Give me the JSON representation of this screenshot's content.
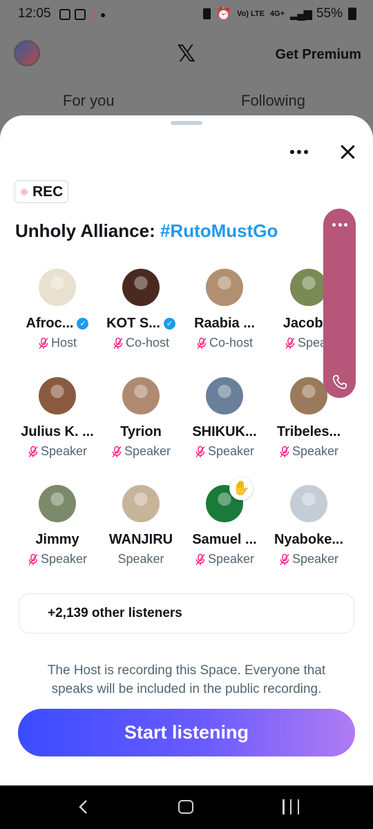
{
  "status_bar": {
    "time": "12:05",
    "network": "Vo) LTE",
    "network_type": "4G+",
    "battery": "55%"
  },
  "background_app": {
    "premium_label": "Get Premium",
    "tabs": [
      "For you",
      "Following"
    ]
  },
  "space": {
    "rec_label": "REC",
    "title_prefix": "Unholy Alliance: ",
    "title_hashtag": "#RutoMustGo",
    "participants": [
      {
        "name": "Afroc...",
        "role": "Host",
        "verified": true,
        "muted": true,
        "avatar_color": "#e8e0d0"
      },
      {
        "name": "KOT S...",
        "role": "Co-host",
        "verified": true,
        "muted": true,
        "avatar_color": "#4a2a20"
      },
      {
        "name": "Raabia ...",
        "role": "Co-host",
        "verified": false,
        "muted": true,
        "avatar_color": "#b09070"
      },
      {
        "name": "Jacob...",
        "role": "Speak",
        "verified": false,
        "muted": true,
        "avatar_color": "#7a8a55"
      },
      {
        "name": "Julius K. ...",
        "role": "Speaker",
        "verified": false,
        "muted": true,
        "avatar_color": "#8a5a40"
      },
      {
        "name": "Tyrion",
        "role": "Speaker",
        "verified": false,
        "muted": true,
        "avatar_color": "#b08a70"
      },
      {
        "name": "SHIKUK...",
        "role": "Speaker",
        "verified": false,
        "muted": true,
        "avatar_color": "#6a7f99"
      },
      {
        "name": "Tribeles...",
        "role": "Speaker",
        "verified": false,
        "muted": true,
        "avatar_color": "#9a7a5a"
      },
      {
        "name": "Jimmy",
        "role": "Speaker",
        "verified": false,
        "muted": true,
        "avatar_color": "#7a8a6a"
      },
      {
        "name": "WANJIRU",
        "role": "Speaker",
        "verified": false,
        "muted": false,
        "avatar_color": "#c8b49a"
      },
      {
        "name": "Samuel ...",
        "role": "Speaker",
        "verified": false,
        "muted": true,
        "avatar_color": "#1a7a3a",
        "hand_raised": true
      },
      {
        "name": "Nyaboke...",
        "role": "Speaker",
        "verified": false,
        "muted": true,
        "avatar_color": "#c4cdd5"
      }
    ],
    "listeners_label": "+2,139 other listeners",
    "recording_notice": "The Host is recording this Space. Everyone that speaks will be included in the public recording.",
    "start_button": "Start listening"
  },
  "colors": {
    "accent": "#1d9bf0",
    "pill": "#b65678",
    "button_gradient_start": "#3b4cff",
    "button_gradient_end": "#b07cf2"
  },
  "icons": {
    "more": "more-icon",
    "close": "close-icon",
    "verified": "verified-badge-icon",
    "mic_off": "mic-off-icon",
    "hand": "raised-hand-icon",
    "phone": "phone-icon",
    "x_logo": "x-logo-icon"
  }
}
